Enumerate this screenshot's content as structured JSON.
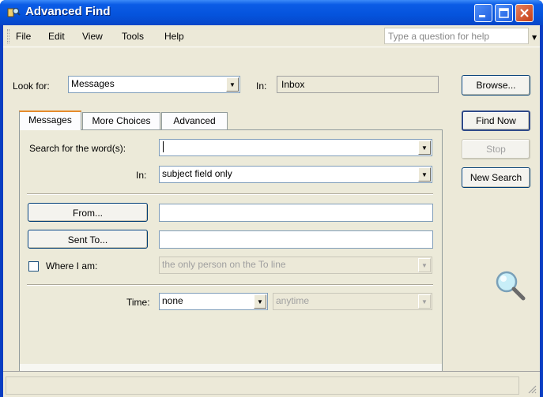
{
  "window": {
    "title": "Advanced Find"
  },
  "menubar": {
    "items": [
      "File",
      "Edit",
      "View",
      "Tools",
      "Help"
    ],
    "help_placeholder": "Type a question for help"
  },
  "top": {
    "look_for_label": "Look for:",
    "look_for_value": "Messages",
    "in_label": "In:",
    "in_value": "Inbox",
    "browse_label": "Browse..."
  },
  "tabs": [
    "Messages",
    "More Choices",
    "Advanced"
  ],
  "messages_tab": {
    "search_label": "Search for the word(s):",
    "search_value": "",
    "in_label": "In:",
    "in_value": "subject field only",
    "from_label": "From...",
    "from_value": "",
    "sent_to_label": "Sent To...",
    "sent_to_value": "",
    "where_i_am_label": "Where I am:",
    "where_i_am_checked": false,
    "where_i_am_value": "the only person on the To line",
    "time_label": "Time:",
    "time_value": "none",
    "time_range_value": "anytime"
  },
  "actions": {
    "find_now": "Find Now",
    "stop": "Stop",
    "new_search": "New Search"
  }
}
